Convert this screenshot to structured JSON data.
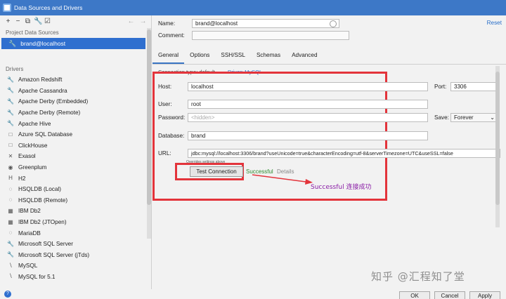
{
  "window": {
    "title": "Data Sources and Drivers"
  },
  "toolbar": {
    "icons": [
      "add-icon",
      "remove-icon",
      "copy-icon",
      "wrench-icon",
      "check-icon"
    ],
    "nav": [
      "back-arrow-icon",
      "forward-arrow-icon"
    ]
  },
  "sidebar": {
    "project_label": "Project Data Sources",
    "project_item": "brand@localhost",
    "drivers_label": "Drivers",
    "drivers": [
      "Amazon Redshift",
      "Apache Cassandra",
      "Apache Derby (Embedded)",
      "Apache Derby (Remote)",
      "Apache Hive",
      "Azure SQL Database",
      "ClickHouse",
      "Exasol",
      "Greenplum",
      "H2",
      "HSQLDB (Local)",
      "HSQLDB (Remote)",
      "IBM Db2",
      "IBM Db2 (JTOpen)",
      "MariaDB",
      "Microsoft SQL Server",
      "Microsoft SQL Server (jTds)",
      "MySQL",
      "MySQL for 5.1"
    ]
  },
  "form": {
    "name_label": "Name:",
    "name_value": "brand@localhost",
    "comment_label": "Comment:",
    "reset": "Reset",
    "tabs": [
      "General",
      "Options",
      "SSH/SSL",
      "Schemas",
      "Advanced"
    ],
    "connection_type": "Connection type: default",
    "driver_link": "Driver: MySQL",
    "host_label": "Host:",
    "host_value": "localhost",
    "port_label": "Port:",
    "port_value": "3306",
    "user_label": "User:",
    "user_value": "root",
    "password_label": "Password:",
    "password_placeholder": "<hidden>",
    "save_label": "Save:",
    "save_value": "Forever",
    "database_label": "Database:",
    "database_value": "brand",
    "url_label": "URL:",
    "url_value": "jdbc:mysql://localhost:3306/brand?useUnicode=true&characterEncoding=utf-8&serverTimezone=UTC&useSSL=false",
    "url_hint": "Overrides settings above",
    "test_button": "Test Connection",
    "status": "Successful",
    "details": "Details"
  },
  "annotation": "Successful 连接成功",
  "buttons": {
    "ok": "OK",
    "cancel": "Cancel",
    "apply": "Apply"
  },
  "watermark": "知乎 @汇程知了堂",
  "colors": {
    "titlebar": "#3d78c7",
    "selection": "#2f6fcf",
    "highlight": "#e3343b",
    "success": "#2e8b2e",
    "annotation": "#8a1da6"
  }
}
